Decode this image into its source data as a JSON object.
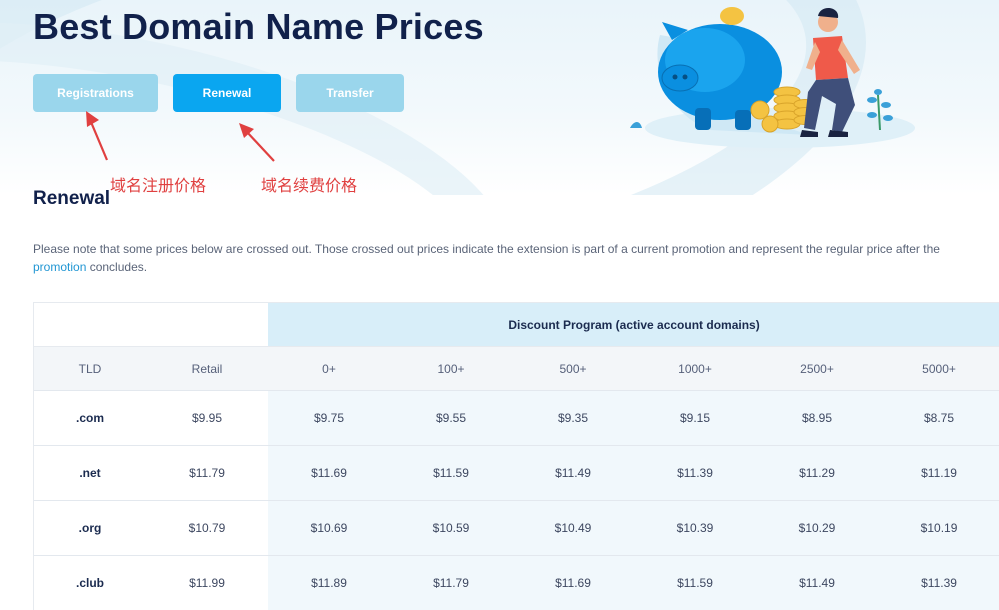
{
  "page": {
    "title": "Best Domain Name Prices",
    "tabs": [
      {
        "label": "Registrations"
      },
      {
        "label": "Renewal"
      },
      {
        "label": "Transfer"
      }
    ]
  },
  "annotations": {
    "registration": "域名注册价格",
    "renewal": "域名续费价格"
  },
  "section": {
    "title": "Renewal",
    "note_text": "Please note that some prices below are crossed out. Those crossed out prices indicate the extension is part of a current promotion and represent the regular price after the ",
    "note_link": "promotion",
    "note_end": " concludes."
  },
  "table": {
    "discount_header": "Discount Program (active account domains)",
    "columns": [
      "TLD",
      "Retail",
      "0+",
      "100+",
      "500+",
      "1000+",
      "2500+",
      "5000+"
    ],
    "rows": [
      [
        ".com",
        "$9.95",
        "$9.75",
        "$9.55",
        "$9.35",
        "$9.15",
        "$8.95",
        "$8.75"
      ],
      [
        ".net",
        "$11.79",
        "$11.69",
        "$11.59",
        "$11.49",
        "$11.39",
        "$11.29",
        "$11.19"
      ],
      [
        ".org",
        "$10.79",
        "$10.69",
        "$10.59",
        "$10.49",
        "$10.39",
        "$10.29",
        "$10.19"
      ],
      [
        ".club",
        "$11.99",
        "$11.89",
        "$11.79",
        "$11.69",
        "$11.59",
        "$11.49",
        "$11.39"
      ]
    ]
  },
  "colors": {
    "active_tab": "#0aa6f0",
    "inactive_tab": "#9ad6ec",
    "annotation": "#e04040",
    "link": "#2196d3"
  }
}
